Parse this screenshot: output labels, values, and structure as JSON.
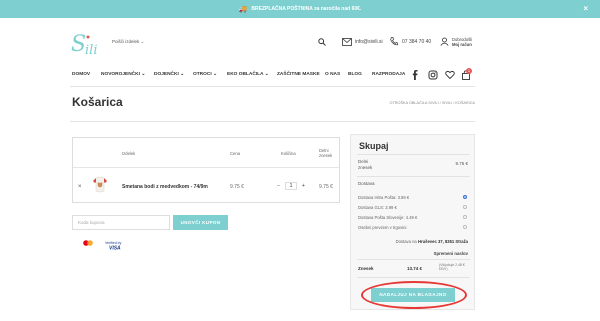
{
  "topbar": {
    "text": "BREZPLAČNA POŠTNINA za naročila nad 60€.",
    "close": "×"
  },
  "header": {
    "search_placeholder": "Poišči izdelek",
    "email": "info@sivili.si",
    "phone": "07 384 70 40",
    "greeting": "Dobrodošli",
    "account": "Moj račun"
  },
  "nav": {
    "items": [
      "DOMOV",
      "NOVOROJENČKI ⌄",
      "DOJENČKI ⌄",
      "OTROCI ⌄",
      "EKO OBLAČILA ⌄",
      "ZAŠČITNE MASKE",
      "O NAS",
      "BLOG",
      "RAZPRODAJA"
    ],
    "cart_count": "1"
  },
  "page": {
    "title": "Košarica",
    "breadcrumb": "OTROŠKA OBLAČILA SIVILI / SIVILI / KOŠARICA"
  },
  "cart": {
    "headers": {
      "product": "Izdelek",
      "price": "Cena",
      "quantity": "Količina",
      "subtotal": "Delni znesek"
    },
    "row": {
      "remove": "×",
      "name": "Smetana bodi z medvedkom - 74/9m",
      "price": "9.75 €",
      "qty_minus": "−",
      "qty_value": "1",
      "qty_plus": "+",
      "subtotal": "9.75 €"
    },
    "coupon_placeholder": "Koda kupona",
    "coupon_button": "UNOVČI KUPON",
    "payment_logos": {
      "mastercard": "MasterCard SecureCode",
      "visa": "Verified by VISA"
    }
  },
  "summary": {
    "title": "Skupaj",
    "subtotal_label": "Delni znesek",
    "subtotal_value": "9.75 €",
    "shipping_label": "Dostava",
    "shipping_options": [
      {
        "label": "Dostava Hitra Pošta: 3.99 €",
        "selected": true
      },
      {
        "label": "Dostava GLS: 3.99 €",
        "selected": false
      },
      {
        "label": "Dostava Pošta Slovenije: 4.49 €",
        "selected": false
      },
      {
        "label": "Osebni prevzem v trgovini",
        "selected": false
      }
    ],
    "ship_to_prefix": "Dostava na",
    "ship_to_address": "Hruševec 37, 8351 Straža",
    "change_address": "Spremeni naslov",
    "total_label": "Znesek",
    "total_value": "13.74 €",
    "vat_note": "(Vključuje 2.48 € DDV)",
    "checkout_button": "NADALJUJ NA BLAGAJNO"
  },
  "colors": {
    "accent": "#7ecfd0",
    "highlight": "#e53935",
    "radio": "#3a6fd8"
  }
}
